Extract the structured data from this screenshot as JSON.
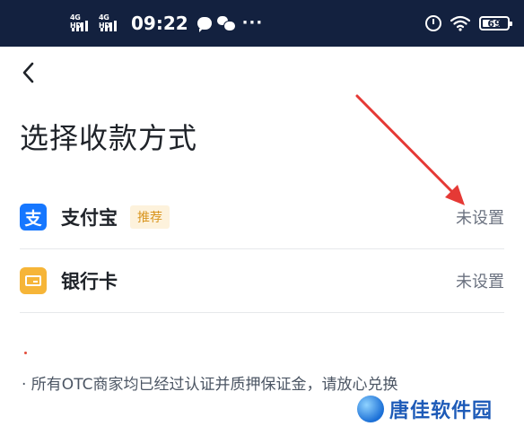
{
  "status_bar": {
    "signal_1": "4G HD",
    "signal_2": "4G HD",
    "time": "09:22",
    "more": "···",
    "battery": "69"
  },
  "page": {
    "title": "选择收款方式"
  },
  "methods": [
    {
      "icon_text": "支",
      "label": "支付宝",
      "badge": "推荐",
      "status": "未设置"
    },
    {
      "label": "银行卡",
      "status": "未设置"
    }
  ],
  "notice": "· 所有OTC商家均已经过认证并质押保证金，请放心兑换",
  "watermark": {
    "text": "唐佳软件园"
  },
  "colors": {
    "status_bar_bg": "#13213f",
    "alipay_blue": "#1677ff",
    "bank_orange": "#f6b538",
    "badge_bg": "#fdf2dc",
    "badge_text": "#d9951f",
    "arrow_red": "#e53935"
  },
  "icons": [
    "back-arrow-icon",
    "alipay-icon",
    "bank-card-icon",
    "alarm-icon",
    "wifi-icon",
    "battery-icon"
  ]
}
